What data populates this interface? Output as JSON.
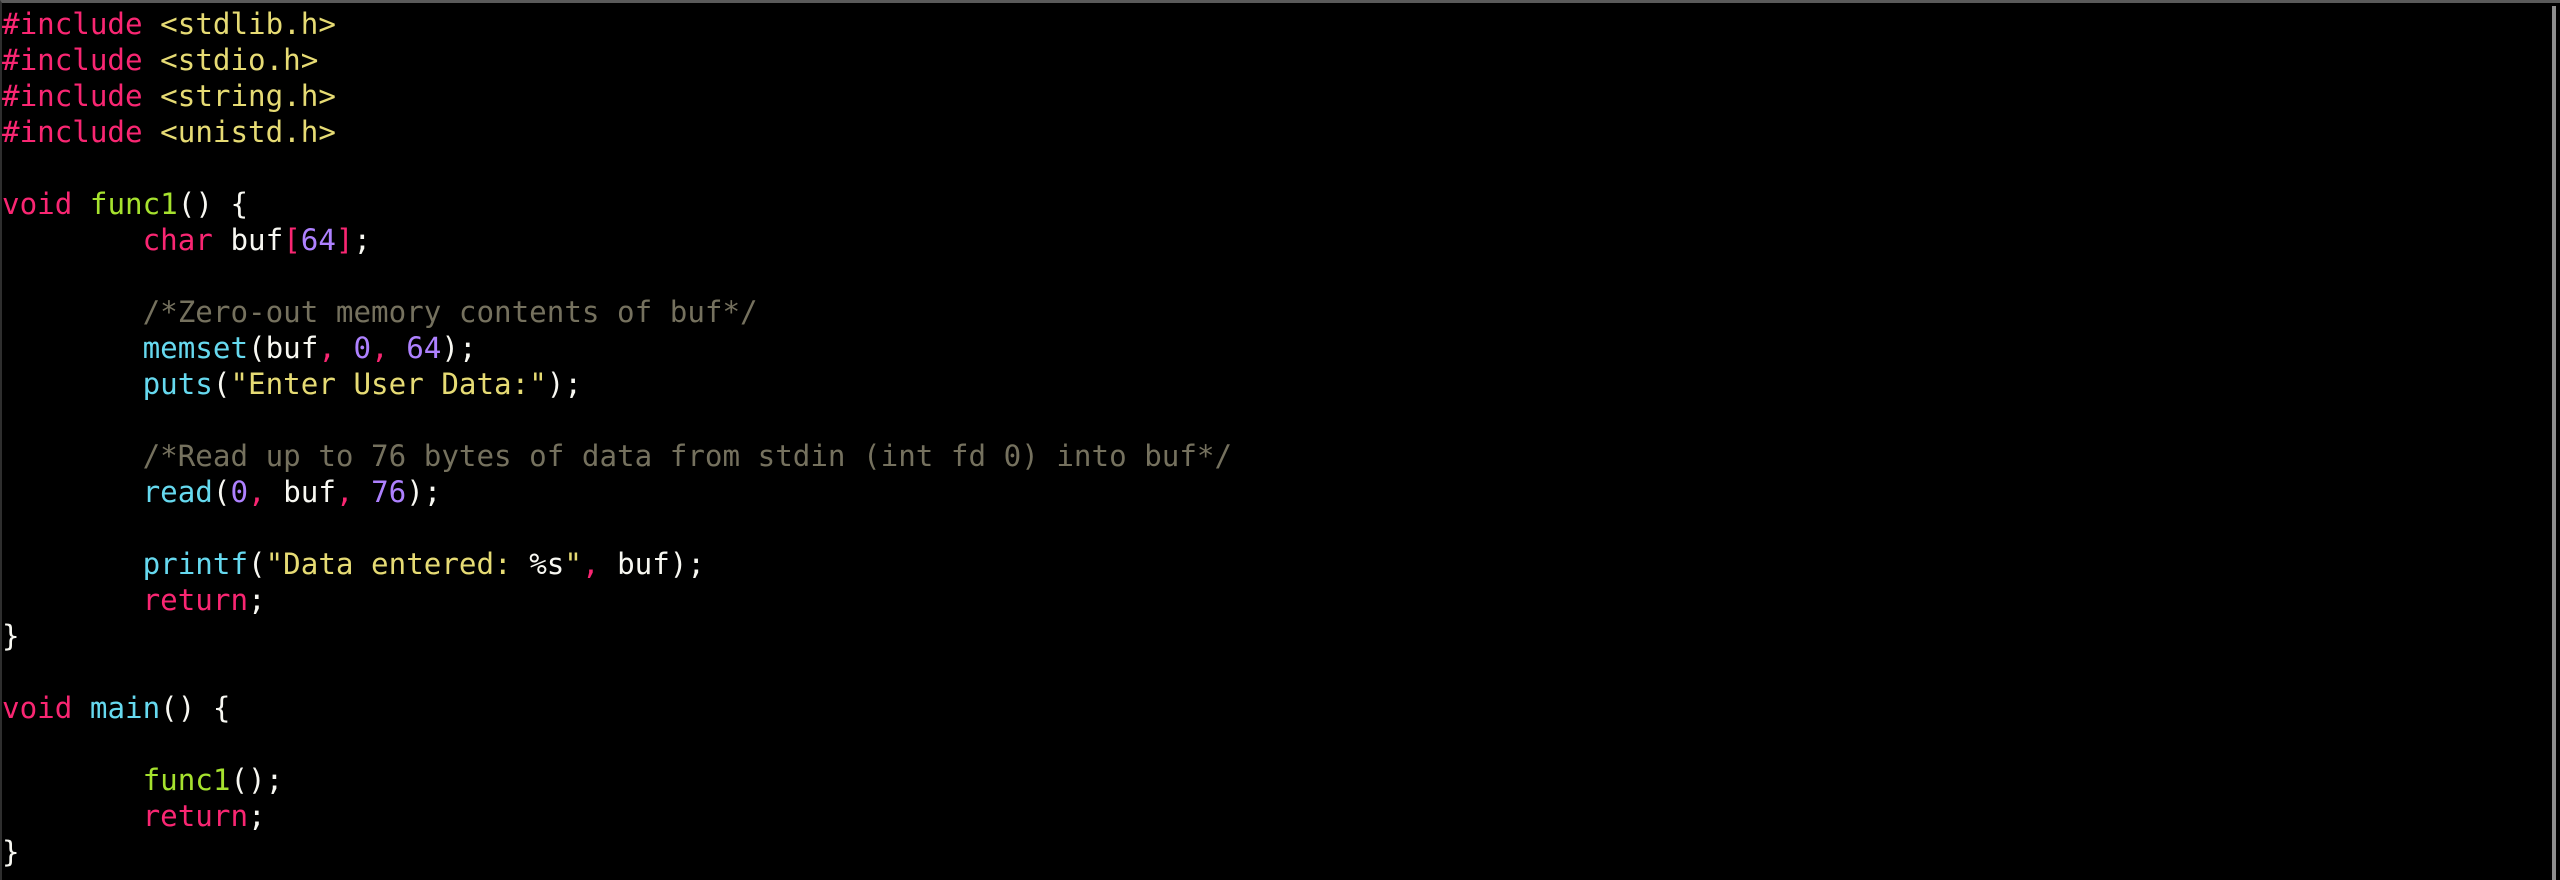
{
  "colors": {
    "background": "#000000",
    "default": "#f8f8f2",
    "preproc": "#f92672",
    "keyword": "#f92672",
    "type": "#f92672",
    "string": "#e6db74",
    "function": "#a6e22e",
    "builtin": "#66d9ef",
    "number": "#ae81ff",
    "comment": "#75715e",
    "punct": "#f92672"
  },
  "code": {
    "lines": [
      [
        {
          "t": "#include",
          "c": "preproc"
        },
        {
          "t": " ",
          "c": "default"
        },
        {
          "t": "<stdlib.h>",
          "c": "string"
        }
      ],
      [
        {
          "t": "#include",
          "c": "preproc"
        },
        {
          "t": " ",
          "c": "default"
        },
        {
          "t": "<stdio.h>",
          "c": "string"
        }
      ],
      [
        {
          "t": "#include",
          "c": "preproc"
        },
        {
          "t": " ",
          "c": "default"
        },
        {
          "t": "<string.h>",
          "c": "string"
        }
      ],
      [
        {
          "t": "#include",
          "c": "preproc"
        },
        {
          "t": " ",
          "c": "default"
        },
        {
          "t": "<unistd.h>",
          "c": "string"
        }
      ],
      [],
      [
        {
          "t": "void",
          "c": "type"
        },
        {
          "t": " ",
          "c": "default"
        },
        {
          "t": "func1",
          "c": "function"
        },
        {
          "t": "() {",
          "c": "default"
        }
      ],
      [
        {
          "t": "        ",
          "c": "default"
        },
        {
          "t": "char",
          "c": "type"
        },
        {
          "t": " buf",
          "c": "default"
        },
        {
          "t": "[",
          "c": "punct"
        },
        {
          "t": "64",
          "c": "number"
        },
        {
          "t": "]",
          "c": "punct"
        },
        {
          "t": ";",
          "c": "default"
        }
      ],
      [],
      [
        {
          "t": "        ",
          "c": "default"
        },
        {
          "t": "/*Zero-out memory contents of buf*/",
          "c": "comment"
        }
      ],
      [
        {
          "t": "        ",
          "c": "default"
        },
        {
          "t": "memset",
          "c": "builtin"
        },
        {
          "t": "(buf",
          "c": "default"
        },
        {
          "t": ",",
          "c": "punct"
        },
        {
          "t": " ",
          "c": "default"
        },
        {
          "t": "0",
          "c": "number"
        },
        {
          "t": ",",
          "c": "punct"
        },
        {
          "t": " ",
          "c": "default"
        },
        {
          "t": "64",
          "c": "number"
        },
        {
          "t": ");",
          "c": "default"
        }
      ],
      [
        {
          "t": "        ",
          "c": "default"
        },
        {
          "t": "puts",
          "c": "builtin"
        },
        {
          "t": "(",
          "c": "default"
        },
        {
          "t": "\"Enter User Data:\"",
          "c": "string"
        },
        {
          "t": ");",
          "c": "default"
        }
      ],
      [],
      [
        {
          "t": "        ",
          "c": "default"
        },
        {
          "t": "/*Read up to 76 bytes of data from stdin (int fd 0) into buf*/",
          "c": "comment"
        }
      ],
      [
        {
          "t": "        ",
          "c": "default"
        },
        {
          "t": "read",
          "c": "builtin"
        },
        {
          "t": "(",
          "c": "default"
        },
        {
          "t": "0",
          "c": "number"
        },
        {
          "t": ",",
          "c": "punct"
        },
        {
          "t": " buf",
          "c": "default"
        },
        {
          "t": ",",
          "c": "punct"
        },
        {
          "t": " ",
          "c": "default"
        },
        {
          "t": "76",
          "c": "number"
        },
        {
          "t": ");",
          "c": "default"
        }
      ],
      [],
      [
        {
          "t": "        ",
          "c": "default"
        },
        {
          "t": "printf",
          "c": "builtin"
        },
        {
          "t": "(",
          "c": "default"
        },
        {
          "t": "\"Data entered: ",
          "c": "string"
        },
        {
          "t": "%s",
          "c": "default"
        },
        {
          "t": "\"",
          "c": "string"
        },
        {
          "t": ",",
          "c": "punct"
        },
        {
          "t": " buf);",
          "c": "default"
        }
      ],
      [
        {
          "t": "        ",
          "c": "default"
        },
        {
          "t": "return",
          "c": "keyword"
        },
        {
          "t": ";",
          "c": "default"
        }
      ],
      [
        {
          "t": "}",
          "c": "default"
        }
      ],
      [],
      [
        {
          "t": "void",
          "c": "type"
        },
        {
          "t": " ",
          "c": "default"
        },
        {
          "t": "main",
          "c": "builtin"
        },
        {
          "t": "() {",
          "c": "default"
        }
      ],
      [],
      [
        {
          "t": "        ",
          "c": "default"
        },
        {
          "t": "func1",
          "c": "function"
        },
        {
          "t": "();",
          "c": "default"
        }
      ],
      [
        {
          "t": "        ",
          "c": "default"
        },
        {
          "t": "return",
          "c": "keyword"
        },
        {
          "t": ";",
          "c": "default"
        }
      ],
      [
        {
          "t": "}",
          "c": "default"
        }
      ]
    ]
  }
}
